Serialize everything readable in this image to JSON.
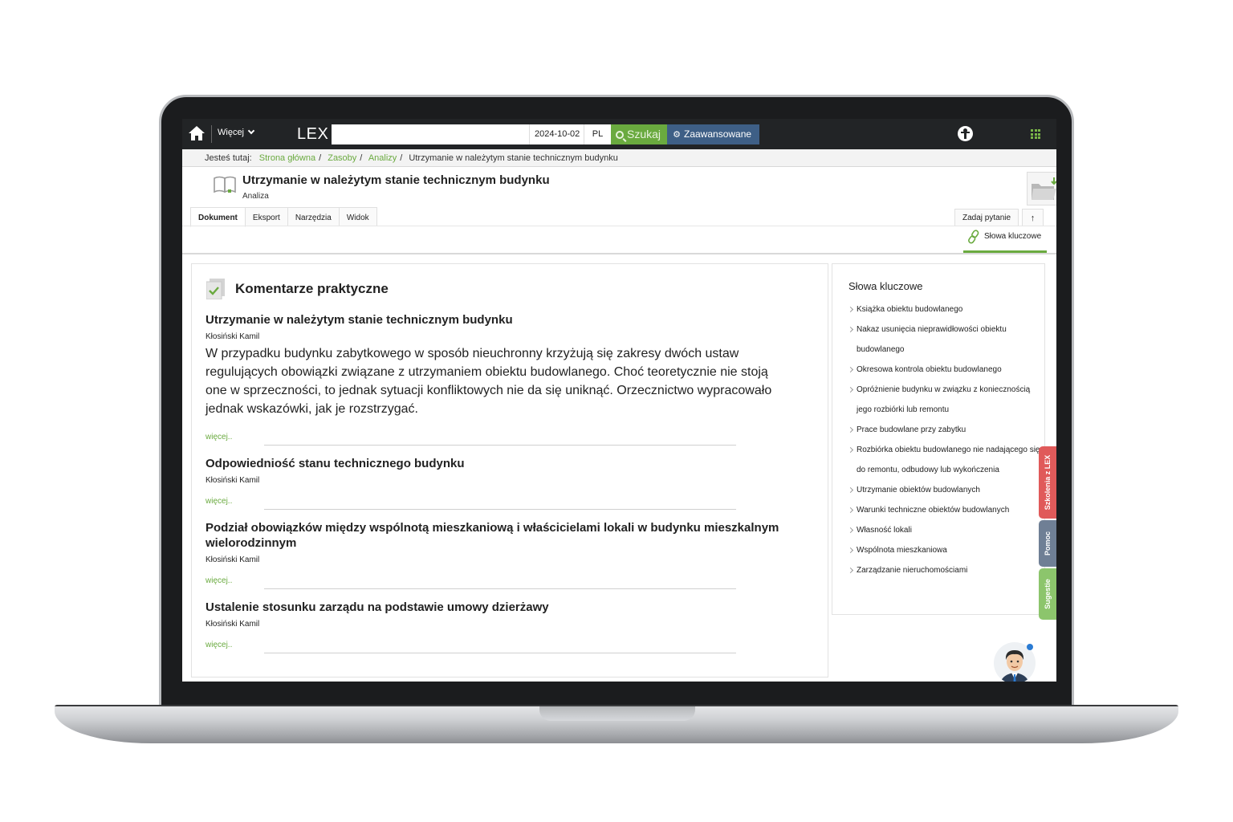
{
  "topbar": {
    "more_label": "Więcej",
    "logo": "LEX",
    "search_placeholder": "",
    "date": "2024-10-02",
    "lang": "PL",
    "search_label": "Szukaj",
    "advanced_label": "Zaawansowane"
  },
  "breadcrumb": {
    "prefix": "Jesteś tutaj:",
    "items": [
      "Strona główna",
      "Zasoby",
      "Analizy"
    ],
    "current": "Utrzymanie w należytym stanie technicznym budynku"
  },
  "document": {
    "title": "Utrzymanie w należytym stanie technicznym budynku",
    "subtitle": "Analiza"
  },
  "tabs": [
    "Dokument",
    "Eksport",
    "Narzędzia",
    "Widok"
  ],
  "ask_label": "Zadaj pytanie",
  "up_label": "↑",
  "keywords_tab": "Słowa kluczowe",
  "main": {
    "category": "Komentarze praktyczne",
    "more_label": "więcej..",
    "items": [
      {
        "title": "Utrzymanie w należytym stanie technicznym budynku",
        "author": "Kłosiński Kamil",
        "text": "W przypadku budynku zabytkowego w sposób nieuchronny krzyżują się zakresy dwóch ustaw regulujących obowiązki związane z utrzymaniem obiektu budowlanego. Choć teoretycznie nie stoją one w sprzeczności, to jednak sytuacji konfliktowych nie da się uniknąć. Orzecznictwo wypracowało jednak wskazówki, jak je rozstrzygać."
      },
      {
        "title": "Odpowiedniość stanu technicznego budynku",
        "author": "Kłosiński Kamil"
      },
      {
        "title": "Podział obowiązków między wspólnotą mieszkaniową i właścicielami lokali w budynku mieszkalnym wielorodzinnym",
        "author": "Kłosiński Kamil"
      },
      {
        "title": "Ustalenie stosunku zarządu na podstawie umowy dzierżawy",
        "author": "Kłosiński Kamil"
      }
    ]
  },
  "keywords": {
    "title": "Słowa kluczowe",
    "items": [
      "Książka obiektu budowlanego",
      "Nakaz usunięcia nieprawidłowości obiektu budowlanego",
      "Okresowa kontrola obiektu budowlanego",
      "Opróżnienie budynku w związku z koniecznością jego rozbiórki lub remontu",
      "Prace budowlane przy zabytku",
      "Rozbiórka obiektu budowlanego nie nadającego się do remontu, odbudowy lub wykończenia",
      "Utrzymanie obiektów budowlanych",
      "Warunki techniczne obiektów budowlanych",
      "Własność lokali",
      "Wspólnota mieszkaniowa",
      "Zarządzanie nieruchomościami"
    ]
  },
  "side_tabs": {
    "training": "Szkolenia z LEX",
    "help": "Pomoc",
    "suggestions": "Sugestie"
  },
  "colors": {
    "accent_green": "#6aaa3f",
    "advanced_blue": "#3e5f86",
    "training_red": "#e05a5a",
    "help_slate": "#6f7f95",
    "suggest_green": "#8cc56c"
  }
}
